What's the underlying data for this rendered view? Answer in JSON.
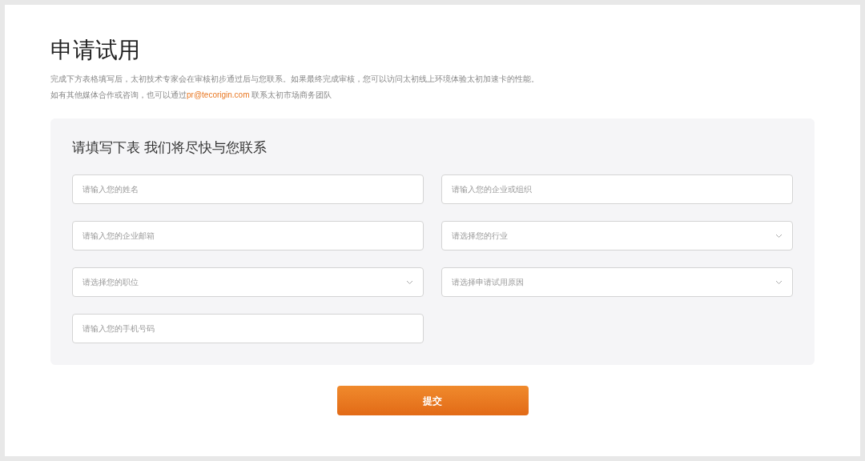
{
  "title": "申请试用",
  "intro": "完成下方表格填写后，太初技术专家会在审核初步通过后与您联系。如果最终完成审核，您可以访问太初线上环境体验太初加速卡的性能。",
  "contact": {
    "before": "如有其他媒体合作或咨询，也可以通过",
    "link": "pr@tecorigin.com",
    "after": "联系太初市场商务团队"
  },
  "form": {
    "heading": "请填写下表 我们将尽快与您联系",
    "fields": [
      {
        "kind": "input",
        "placeholder": "请输入您的姓名"
      },
      {
        "kind": "input",
        "placeholder": "请输入您的企业或组织"
      },
      {
        "kind": "input",
        "placeholder": "请输入您的企业邮箱"
      },
      {
        "kind": "select",
        "placeholder": "请选择您的行业"
      },
      {
        "kind": "select",
        "placeholder": "请选择您的职位"
      },
      {
        "kind": "select",
        "placeholder": "请选择申请试用原因"
      },
      {
        "kind": "input",
        "placeholder": "请输入您的手机号码"
      }
    ]
  },
  "submit": "提交"
}
